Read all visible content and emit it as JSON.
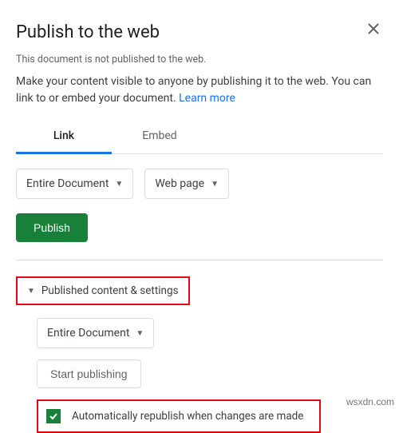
{
  "dialog": {
    "title": "Publish to the web",
    "status": "This document is not published to the web.",
    "description": "Make your content visible to anyone by publishing it to the web. You can link to or embed your document. ",
    "learn_more": "Learn more"
  },
  "tabs": {
    "link": "Link",
    "embed": "Embed"
  },
  "dropdown_scope": {
    "label": "Entire Document"
  },
  "dropdown_format": {
    "label": "Web page"
  },
  "publish_button": "Publish",
  "settings": {
    "header": "Published content & settings",
    "scope": "Entire Document",
    "start_button": "Start publishing",
    "auto_republish": "Automatically republish when changes are made"
  },
  "watermark": "wsxdn.com"
}
